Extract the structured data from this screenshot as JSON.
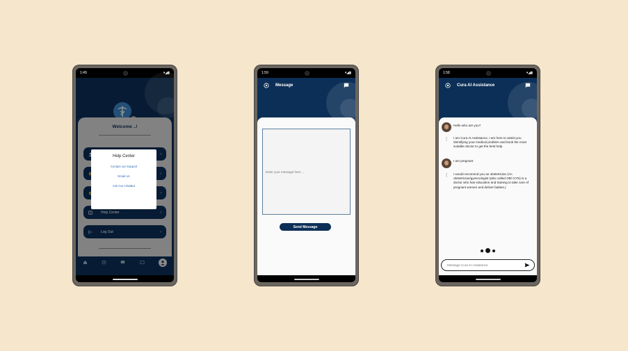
{
  "phone1": {
    "status": {
      "time": "1:49"
    },
    "welcome": "Welcome ..!",
    "menu": [
      {
        "label": "",
        "icon": "user-icon"
      },
      {
        "label": "",
        "icon": "gear-icon"
      },
      {
        "label": "",
        "icon": "settings-icon"
      },
      {
        "label": "Help Center",
        "icon": "book-icon"
      },
      {
        "label": "Log Out",
        "icon": "logout-icon"
      }
    ],
    "dialog": {
      "title": "Help Center",
      "options": [
        "Contact our Support",
        "Email Us",
        "Ask Our ChatBot"
      ]
    }
  },
  "phone2": {
    "status": {
      "time": "1:59"
    },
    "title": "Message",
    "placeholder": "Enter your message here ...",
    "send_label": "Send Message"
  },
  "phone3": {
    "status": {
      "time": "1:58"
    },
    "title": "Cura AI Assistance",
    "messages": [
      {
        "from": "user",
        "text": "Hello who are you?"
      },
      {
        "from": "bot",
        "text": "I am Cura AI Assistance, I am here to assist you identifying your medical problem and book the most suitable doctor to get the best help"
      },
      {
        "from": "user",
        "text": "I am pregnant"
      },
      {
        "from": "bot",
        "text": "I would recomend you an obstetrician (An obstetrician/gynecologist (also called OB/ GYN) is a doctor who has education and training to take care of pregnant women and deliver babies.)"
      }
    ],
    "input_placeholder": "Message Cura AI Assistance"
  },
  "colors": {
    "background": "#f5e6cc",
    "navy": "#0c2f57",
    "link": "#2f6db5"
  }
}
